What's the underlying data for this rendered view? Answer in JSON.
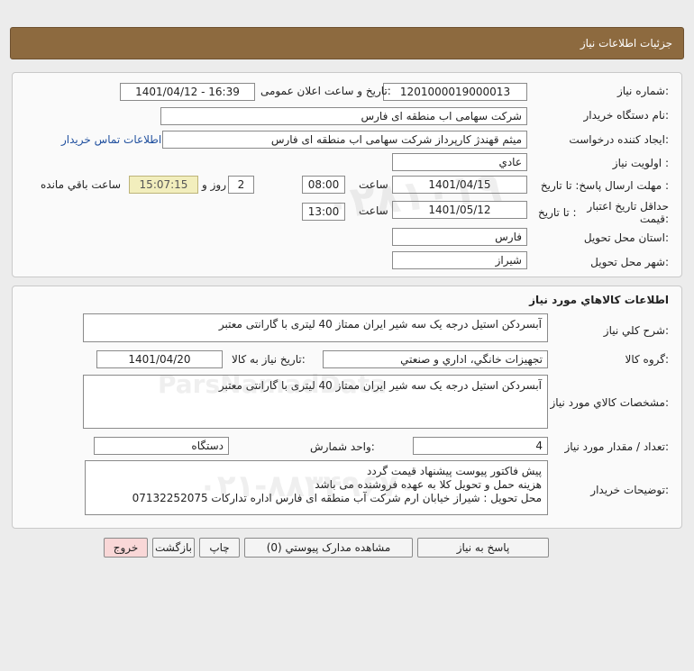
{
  "header": {
    "title": "جزئيات اطلاعات نياز"
  },
  "details": {
    "need_number_label": "شماره نياز:",
    "need_number": "1201000019000013",
    "announce_label": "تاريخ و ساعت اعلان عمومی:",
    "announce_value": "1401/04/12 - 16:39",
    "buyer_label": "نام دستگاه خريدار:",
    "buyer": "شرکت سهامی اب منطقه ای فارس",
    "creator_label": "ايجاد کننده درخواست:",
    "creator": "میثم قهندژ کارپرداز شرکت سهامی اب منطقه ای فارس",
    "contact_link": "اطلاعات تماس خريدار",
    "priority_label": "اولويت نياز :",
    "priority": "عادي",
    "deadline_label": "مهلت ارسال پاسخ:  تا تاريخ :",
    "deadline_date": "1401/04/15",
    "time_label": "ساعت",
    "deadline_time": "08:00",
    "days_value": "2",
    "days_label": "روز و",
    "remaining_time": "15:07:15",
    "remaining_label": "ساعت باقي مانده",
    "validity_label_1": "حداقل تاريخ اعتبار",
    "validity_label_2": "قيمت:",
    "validity_to_label": "تا تاريخ :",
    "validity_date": "1401/05/12",
    "validity_time": "13:00",
    "province_label": "استان محل تحويل:",
    "province": "فارس",
    "city_label": "شهر محل تحويل:",
    "city": "شيراز"
  },
  "goods": {
    "section_title": "اطلاعات کالاهاي مورد نياز",
    "summary_label": "شرح کلي نياز:",
    "summary": "آبسردکن استیل درجه یک سه شیر ایران ممتاز 40 لیتری با گارانتی معتبر",
    "group_label": "گروه کالا:",
    "group": "تجهيزات خانگي، اداري و صنعتي",
    "need_date_label": "تاريخ نياز به کالا:",
    "need_date": "1401/04/20",
    "spec_label": "مشخصات کالاي مورد نياز:",
    "spec": "آبسردکن استیل درجه یک سه شیر  ایران ممتاز 40 لیتری با گارانتی معتبر",
    "qty_label": "تعداد / مقدار مورد نياز:",
    "qty": "4",
    "unit_label": "واحد شمارش:",
    "unit": "دستگاه",
    "notes_label": "توضيحات خريدار:",
    "notes_1": "پیش فاکتور پیوست پیشنهاد قیمت گردد",
    "notes_2": "هزینه حمل و تحویل کلا به عهده فروشنده می باشد",
    "notes_3": "محل تحویل : شیراز خیابان ارم شرکت آب منطقه ای فارس اداره تدارکات 07132252075"
  },
  "buttons": {
    "reply": "پاسخ به نياز",
    "attachments": "مشاهده مدارک پيوستي (0)",
    "print": "چاپ",
    "back": "بازگشت",
    "exit": "خروج"
  },
  "colors": {
    "header": "#8d6a3f",
    "timer_bg": "#f2eebd",
    "exit_bg": "#f9d7d7",
    "link": "#1f4f9e"
  }
}
